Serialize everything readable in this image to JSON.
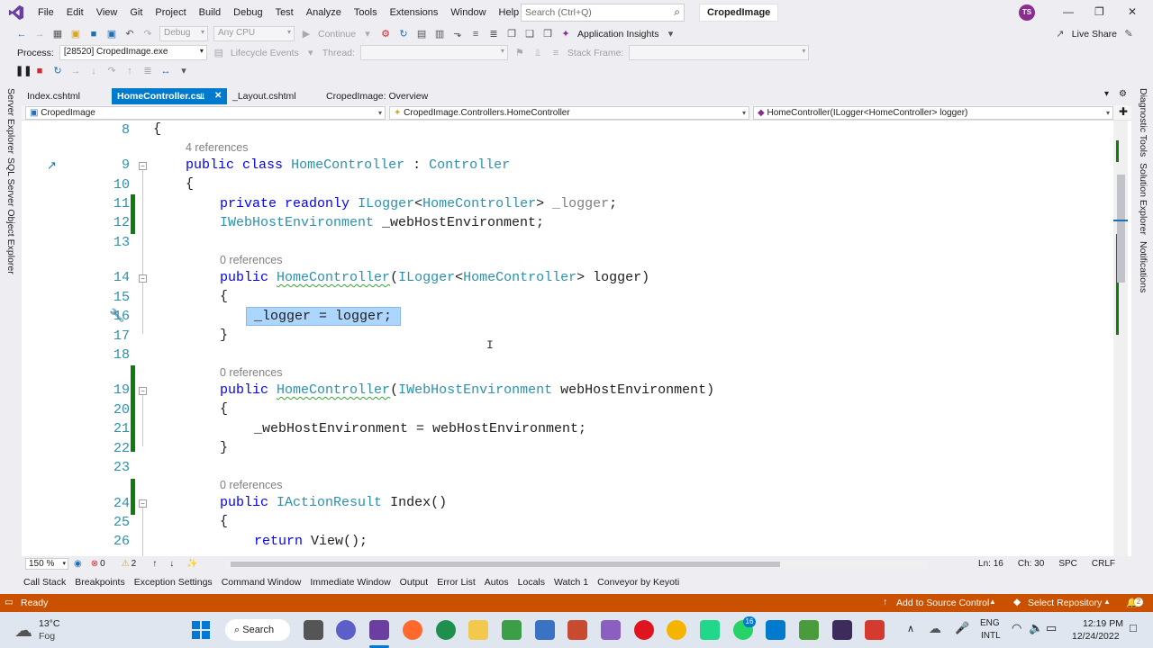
{
  "menu": [
    "File",
    "Edit",
    "View",
    "Git",
    "Project",
    "Build",
    "Debug",
    "Test",
    "Analyze",
    "Tools",
    "Extensions",
    "Window",
    "Help"
  ],
  "search": {
    "placeholder": "Search (Ctrl+Q)"
  },
  "solution_name": "CropedImage",
  "user_initials": "TS",
  "toolbar": {
    "config": "Debug",
    "platform": "Any CPU",
    "continue_label": "Continue",
    "app_insights": "Application Insights",
    "live_share": "Live Share"
  },
  "debug_bar": {
    "process_label": "Process:",
    "process_value": "[28520] CropedImage.exe",
    "lifecycle": "Lifecycle Events",
    "thread": "Thread:",
    "stack_frame": "Stack Frame:"
  },
  "tabs": [
    {
      "label": "Index.cshtml",
      "active": false
    },
    {
      "label": "HomeController.cs",
      "active": true
    },
    {
      "label": "_Layout.cshtml",
      "active": false
    },
    {
      "label": "CropedImage: Overview",
      "active": false
    }
  ],
  "navbar": {
    "project": "CropedImage",
    "type": "CropedImage.Controllers.HomeController",
    "member": "HomeController(ILogger<HomeController> logger)"
  },
  "left_strip": {
    "server_explorer": "Server Explorer",
    "sql_explorer": "SQL Server Object Explorer"
  },
  "right_strip": {
    "diagnostic": "Diagnostic Tools",
    "solution_explorer": "Solution Explorer",
    "notifications": "Notifications"
  },
  "code_lines": [
    {
      "n": "8",
      "text": "{"
    },
    {
      "refs": "4 references"
    },
    {
      "n": "9",
      "text": "public class HomeController : Controller"
    },
    {
      "n": "10",
      "text": "{"
    },
    {
      "n": "11",
      "text": "private readonly ILogger<HomeController> _logger;"
    },
    {
      "n": "12",
      "text": "IWebHostEnvironment _webHostEnvironment;"
    },
    {
      "n": "13",
      "text": ""
    },
    {
      "refs": "0 references"
    },
    {
      "n": "14",
      "text": "public HomeController(ILogger<HomeController> logger)"
    },
    {
      "n": "15",
      "text": "{"
    },
    {
      "n": "16",
      "text": "_logger = logger;"
    },
    {
      "n": "17",
      "text": "}"
    },
    {
      "n": "18",
      "text": ""
    },
    {
      "refs": "0 references"
    },
    {
      "n": "19",
      "text": "public HomeController(IWebHostEnvironment webHostEnvironment)"
    },
    {
      "n": "20",
      "text": "{"
    },
    {
      "n": "21",
      "text": "_webHostEnvironment = webHostEnvironment;"
    },
    {
      "n": "22",
      "text": "}"
    },
    {
      "n": "23",
      "text": ""
    },
    {
      "refs": "0 references"
    },
    {
      "n": "24",
      "text": "public IActionResult Index()"
    },
    {
      "n": "25",
      "text": "{"
    },
    {
      "n": "26",
      "text": "return View();"
    }
  ],
  "editor_status": {
    "zoom": "150 %",
    "errors": "0",
    "warnings": "2",
    "ln": "Ln: 16",
    "ch": "Ch: 30",
    "spc": "SPC",
    "crlf": "CRLF"
  },
  "tool_windows": [
    "Call Stack",
    "Breakpoints",
    "Exception Settings",
    "Command Window",
    "Immediate Window",
    "Output",
    "Error List",
    "Autos",
    "Locals",
    "Watch 1",
    "Conveyor by Keyoti"
  ],
  "status": {
    "ready": "Ready",
    "add_source": "Add to Source Control",
    "select_repo": "Select Repository",
    "notif_count": "2"
  },
  "taskbar": {
    "weather_temp": "13°C",
    "weather_desc": "Fog",
    "search_label": "Search",
    "lang1": "ENG",
    "lang2": "INTL",
    "time": "12:19 PM",
    "date": "12/24/2022",
    "badge": "16"
  },
  "colors": {
    "accent": "#007acc",
    "status_orange": "#ca5100",
    "keyword": "#0000ff",
    "type": "#2b91af",
    "change_green": "#107c10"
  }
}
